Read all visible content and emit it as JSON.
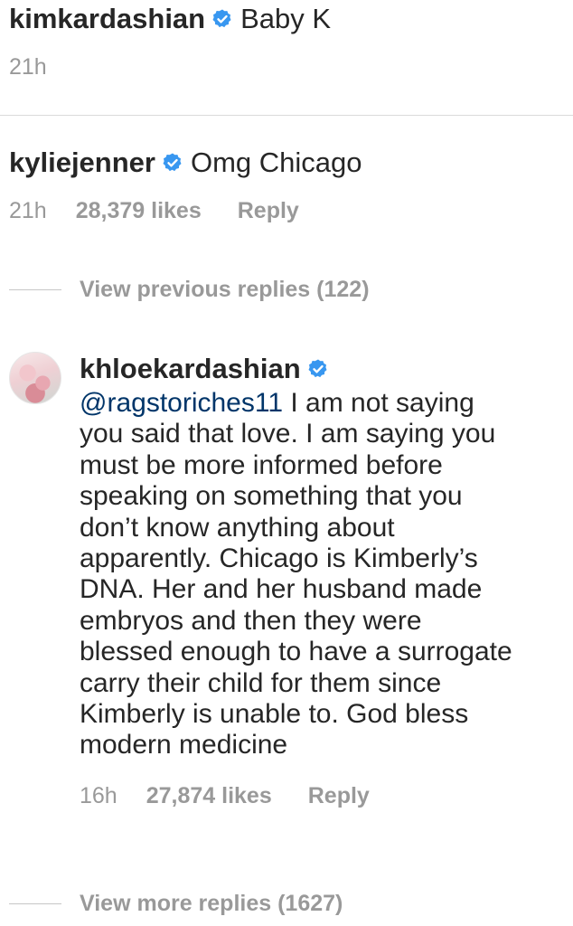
{
  "comments": [
    {
      "username": "kimkardashian",
      "text": "Baby K",
      "time": "21h"
    },
    {
      "username": "kyliejenner",
      "text": "Omg Chicago",
      "time": "21h",
      "likes": "28,379 likes",
      "reply_label": "Reply"
    }
  ],
  "view_previous_replies": "View previous replies (122)",
  "reply": {
    "username": "khloekardashian",
    "mention": "@ragstoriches11",
    "lines": [
      " I am not saying",
      "you said that love. I am saying you",
      "must be more informed before",
      "speaking on something that you",
      "don’t know anything about",
      "apparently. Chicago is Kimberly’s",
      "DNA. Her and her husband made",
      "embryos and then they were",
      "blessed enough to have a surrogate",
      "carry their child for them since",
      "Kimberly is unable to. God bless",
      "modern medicine"
    ],
    "time": "16h",
    "likes": "27,874 likes",
    "reply_label": "Reply"
  },
  "view_more_replies": "View more replies (1627)",
  "colors": {
    "text": "#262626",
    "muted": "#999999",
    "verified_badge": "#3897f0",
    "mention": "#003569",
    "divider": "#dbdbdb"
  },
  "icons": {
    "verified": "verified-badge-icon"
  }
}
